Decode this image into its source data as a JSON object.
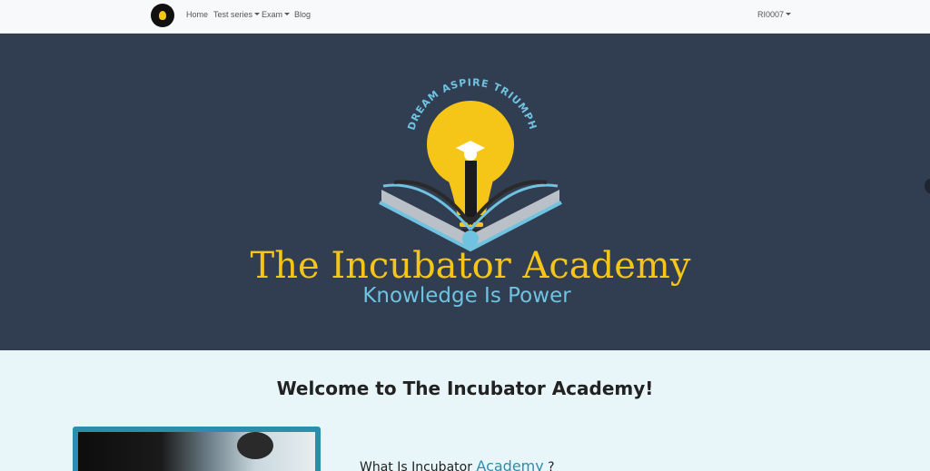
{
  "navbar": {
    "brand_logo": "bulb-logo-icon",
    "items": [
      {
        "label": "Home",
        "dropdown": false
      },
      {
        "label": "Test series",
        "dropdown": true
      },
      {
        "label": "Exam",
        "dropdown": true
      },
      {
        "label": "Blog",
        "dropdown": false
      }
    ],
    "user": {
      "label": "RI0007",
      "dropdown": true
    }
  },
  "hero": {
    "logo_arc_text": "DREAM ASPIRE TRIUMPH",
    "title": "The Incubator Academy",
    "subtitle": "Knowledge Is Power"
  },
  "welcome": {
    "heading": "Welcome to The Incubator Academy!",
    "intro_prefix": "What Is Incubator ",
    "intro_accent": "Academy",
    "intro_suffix": " ?"
  },
  "colors": {
    "hero_bg": "#313d51",
    "brand_yellow": "#f5c518",
    "brand_blue": "#6fc3e0",
    "accent_teal": "#2b8eac",
    "section_bg": "#e8f6f9"
  }
}
